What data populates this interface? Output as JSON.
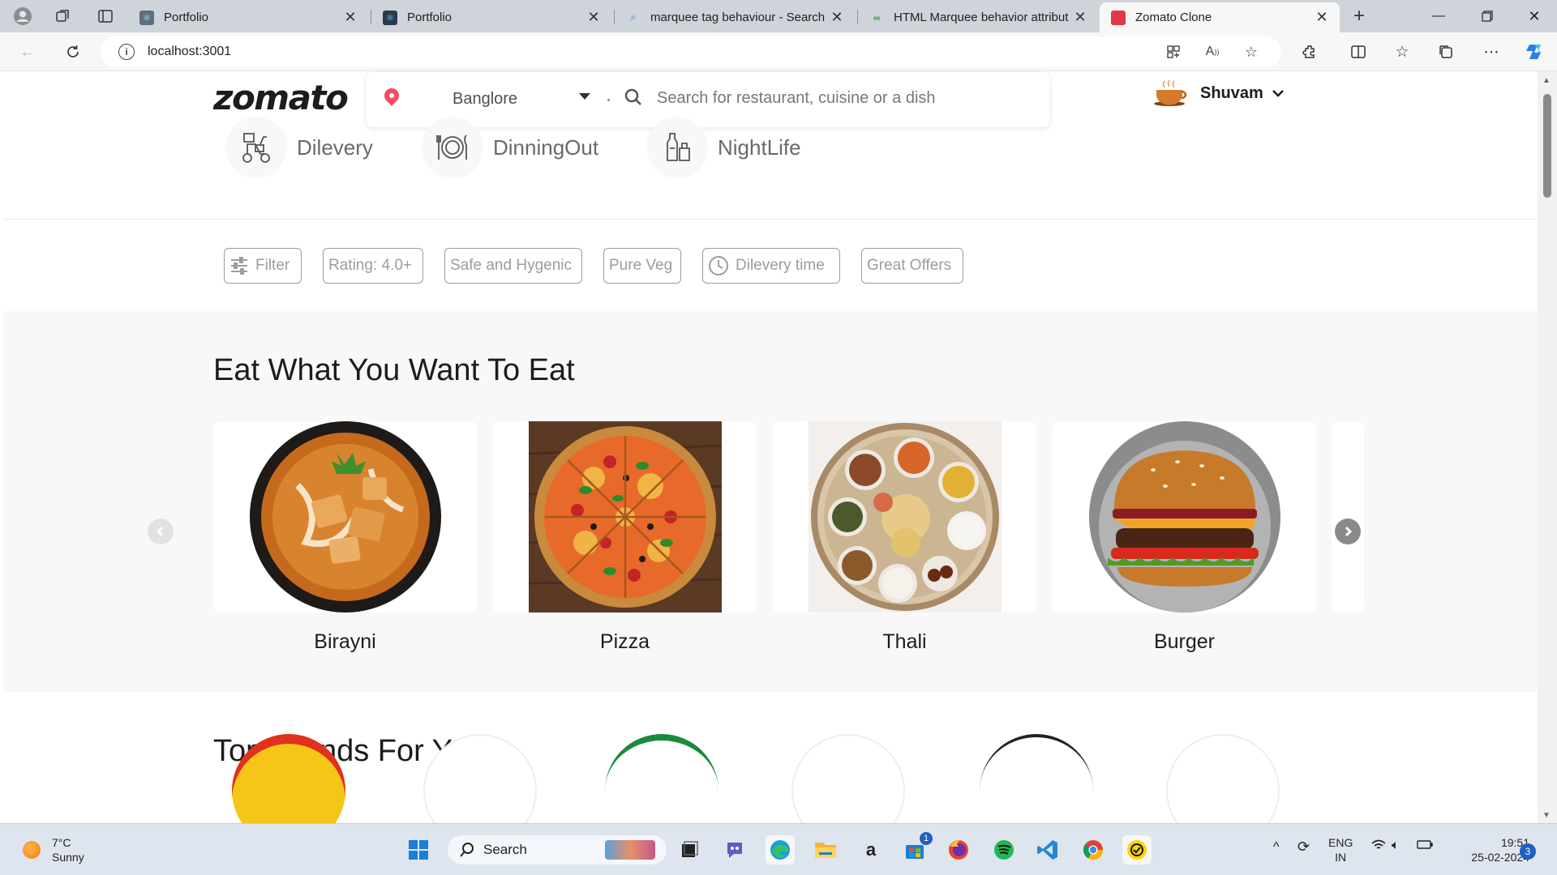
{
  "browser": {
    "tabs": [
      {
        "title": "Portfolio",
        "active": false
      },
      {
        "title": "Portfolio",
        "active": false
      },
      {
        "title": "marquee tag behaviour - Search",
        "active": false
      },
      {
        "title": "HTML Marquee behavior attribut",
        "active": false
      },
      {
        "title": "Zomato Clone",
        "active": true
      }
    ],
    "url": "localhost:3001"
  },
  "header": {
    "logo": "zomato",
    "location": "Banglore",
    "search_placeholder": "Search for restaurant, cuisine or a dish",
    "user_name": "Shuvam"
  },
  "categories": [
    {
      "label": "Dilevery",
      "icon": "scooter-icon"
    },
    {
      "label": "DinningOut",
      "icon": "dining-icon"
    },
    {
      "label": "NightLife",
      "icon": "drinks-icon"
    }
  ],
  "filters": [
    "Filter",
    "Rating: 4.0+",
    "Safe and Hygenic",
    "Pure Veg",
    "Dilevery time",
    "Great Offers"
  ],
  "eat_section": {
    "title": "Eat What You Want To Eat",
    "items": [
      "Birayni",
      "Pizza",
      "Thali",
      "Burger"
    ]
  },
  "brands_section": {
    "title": "Top Brands For You"
  },
  "taskbar": {
    "weather_temp": "7°C",
    "weather_desc": "Sunny",
    "search_label": "Search",
    "lang_top": "ENG",
    "lang_bottom": "IN",
    "time": "19:51",
    "date": "25-02-2024",
    "notifications": "3",
    "store_badge": "1"
  },
  "colors": {
    "brand_red": "#ef4f5f",
    "page_grey": "#f8f8f8"
  }
}
